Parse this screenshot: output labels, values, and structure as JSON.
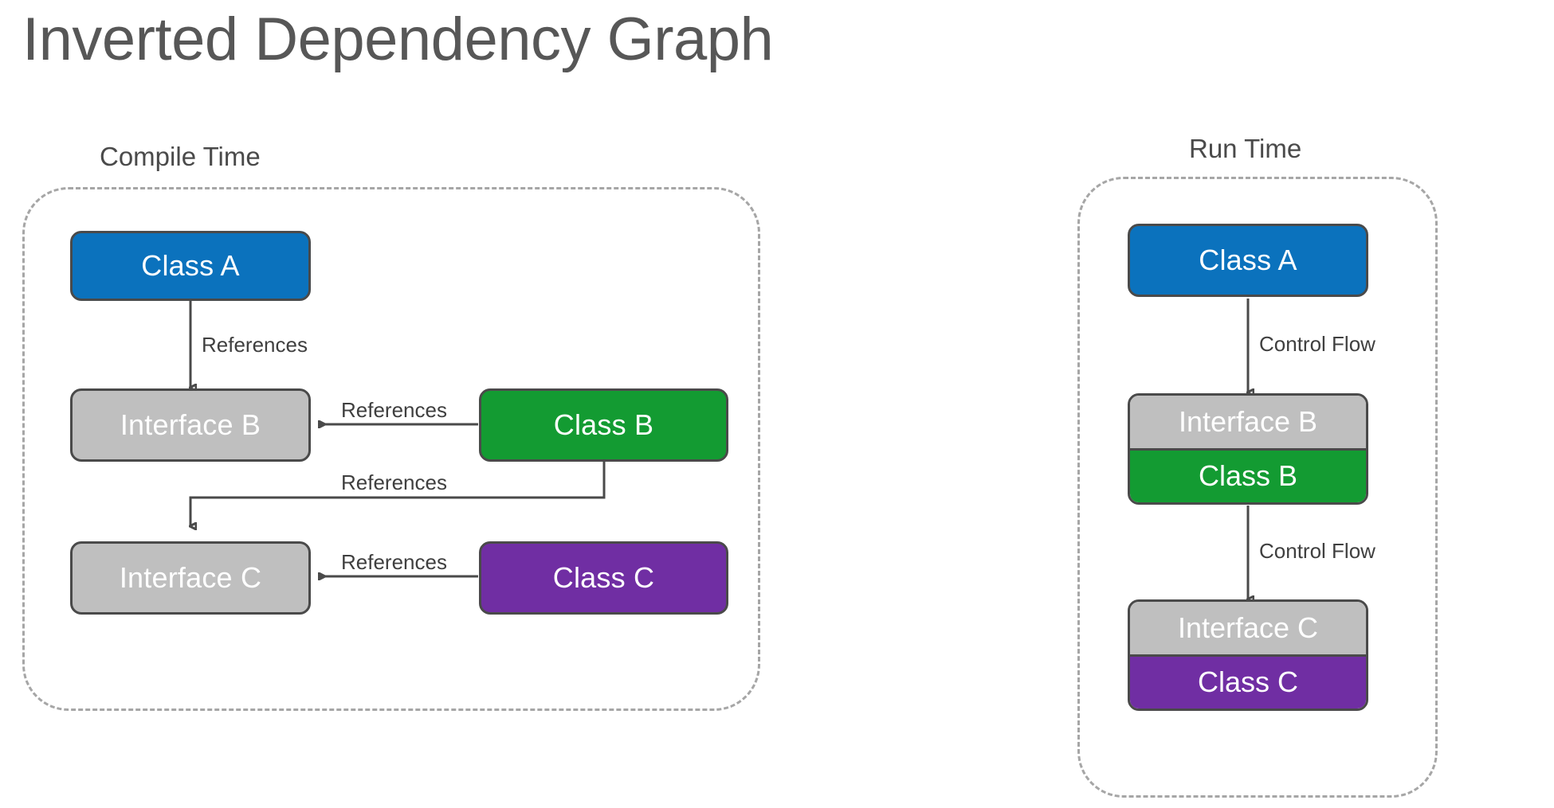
{
  "title": "Inverted Dependency Graph",
  "colors": {
    "class_a": "#0b72bd",
    "class_b": "#139b32",
    "class_c": "#702ea3",
    "interface": "#bfbfbf",
    "border": "#4a4a4a",
    "group_border": "#a6a6a6",
    "title_text": "#575757",
    "label_text": "#3f3f3f"
  },
  "groups": {
    "compile": {
      "caption": "Compile Time"
    },
    "runtime": {
      "caption": "Run Time"
    }
  },
  "compile_time": {
    "nodes": {
      "class_a": "Class A",
      "interface_b": "Interface B",
      "class_b": "Class B",
      "interface_c": "Interface C",
      "class_c": "Class C"
    },
    "edges": [
      {
        "id": "a-to-ib",
        "label": "References",
        "from": "Class A",
        "to": "Interface B"
      },
      {
        "id": "cb-to-ib",
        "label": "References",
        "from": "Class B",
        "to": "Interface B"
      },
      {
        "id": "cb-to-ic",
        "label": "References",
        "from": "Class B",
        "to": "Interface C"
      },
      {
        "id": "cc-to-ic",
        "label": "References",
        "from": "Class C",
        "to": "Interface C"
      }
    ]
  },
  "run_time": {
    "nodes": {
      "class_a": "Class A",
      "interface_b": "Interface B",
      "class_b": "Class B",
      "interface_c": "Interface C",
      "class_c": "Class C"
    },
    "edges": [
      {
        "id": "rt-a-to-b",
        "label": "Control Flow",
        "from": "Class A",
        "to": "Interface B"
      },
      {
        "id": "rt-b-to-c",
        "label": "Control Flow",
        "from": "Class B",
        "to": "Interface C"
      }
    ]
  }
}
